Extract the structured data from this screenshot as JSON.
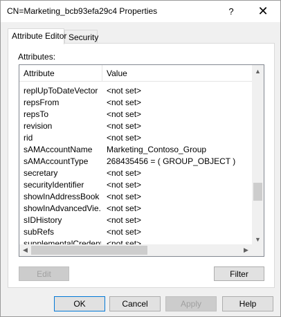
{
  "window": {
    "title": "CN=Marketing_bcb93efa29c4 Properties",
    "help_glyph": "?",
    "close_glyph": "✕"
  },
  "tabs": [
    {
      "label": "Attribute Editor",
      "active": true
    },
    {
      "label": "Security",
      "active": false
    }
  ],
  "attributes_label": "Attributes:",
  "table": {
    "columns": [
      "Attribute",
      "Value"
    ],
    "rows": [
      {
        "attribute": "replUpToDateVector",
        "value": "<not set>"
      },
      {
        "attribute": "repsFrom",
        "value": "<not set>"
      },
      {
        "attribute": "repsTo",
        "value": "<not set>"
      },
      {
        "attribute": "revision",
        "value": "<not set>"
      },
      {
        "attribute": "rid",
        "value": "<not set>"
      },
      {
        "attribute": "sAMAccountName",
        "value": "Marketing_Contoso_Group"
      },
      {
        "attribute": "sAMAccountType",
        "value": "268435456 = ( GROUP_OBJECT )"
      },
      {
        "attribute": "secretary",
        "value": "<not set>"
      },
      {
        "attribute": "securityIdentifier",
        "value": "<not set>"
      },
      {
        "attribute": "showInAddressBook",
        "value": "<not set>"
      },
      {
        "attribute": "showInAdvancedVie...",
        "value": "<not set>"
      },
      {
        "attribute": "sIDHistory",
        "value": "<not set>"
      },
      {
        "attribute": "subRefs",
        "value": "<not set>"
      },
      {
        "attribute": "supplementalCredenti...",
        "value": "<not set>"
      }
    ]
  },
  "buttons": {
    "edit": "Edit",
    "filter": "Filter",
    "ok": "OK",
    "cancel": "Cancel",
    "apply": "Apply",
    "help": "Help"
  },
  "scroll_glyphs": {
    "up": "▲",
    "down": "▼",
    "left": "◀",
    "right": "▶"
  }
}
